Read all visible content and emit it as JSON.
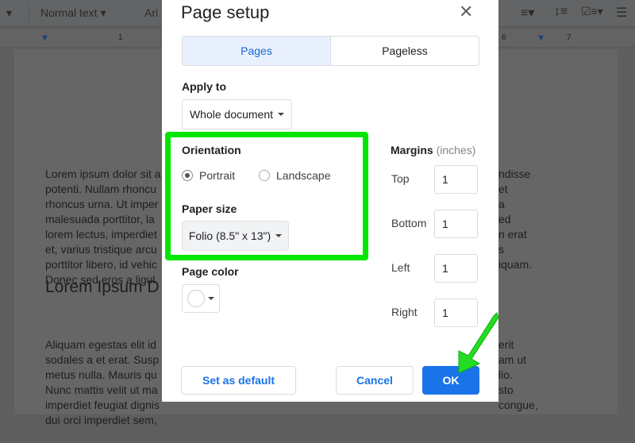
{
  "toolbar": {
    "style": "Normal text",
    "font": "Ari"
  },
  "ruler": {
    "marks": [
      "1",
      "6",
      "7"
    ]
  },
  "document": {
    "left_lines": [
      "Lorem ipsum dolor sit a",
      "potenti. Nullam rhoncu",
      "rhoncus urna. Ut imper",
      "malesuada porttitor, la",
      "lorem lectus, imperdiet",
      "et, varius tristique arcu",
      "porttitor libero, id vehic",
      "Donec sed eros a ligul"
    ],
    "heading": "Lorem Ipsum D",
    "left_lines2": [
      "Aliquam egestas elit id",
      "sodales a et erat. Susp",
      "metus nulla. Mauris qu",
      "Nunc mattis velit ut ma",
      "imperdiet feugiat dignis",
      "dui orci imperdiet sem,"
    ],
    "right_lines": [
      "ndisse",
      "et",
      "a",
      "ed",
      "n erat",
      "s",
      "iquam."
    ],
    "right_lines2": [
      "erit",
      "am ut",
      "lio.",
      "sto",
      "congue,"
    ]
  },
  "dialog": {
    "title": "Page setup",
    "tabs": [
      {
        "label": "Pages",
        "selected": true
      },
      {
        "label": "Pageless",
        "selected": false
      }
    ],
    "apply_to": {
      "label": "Apply to",
      "value": "Whole document"
    },
    "orientation": {
      "label": "Orientation",
      "options": [
        {
          "label": "Portrait",
          "checked": true
        },
        {
          "label": "Landscape",
          "checked": false
        }
      ]
    },
    "paper_size": {
      "label": "Paper size",
      "value": "Folio (8.5\" x 13\")"
    },
    "page_color": {
      "label": "Page color",
      "value": "#ffffff"
    },
    "margins": {
      "label": "Margins",
      "unit": "(inches)",
      "fields": [
        {
          "label": "Top",
          "value": "1"
        },
        {
          "label": "Bottom",
          "value": "1"
        },
        {
          "label": "Left",
          "value": "1"
        },
        {
          "label": "Right",
          "value": "1"
        }
      ]
    },
    "buttons": {
      "default": "Set as default",
      "cancel": "Cancel",
      "ok": "OK"
    }
  },
  "colors": {
    "accent": "#1a73e8",
    "highlight": "#00e600",
    "tab_selected": "#e8f0fe"
  }
}
